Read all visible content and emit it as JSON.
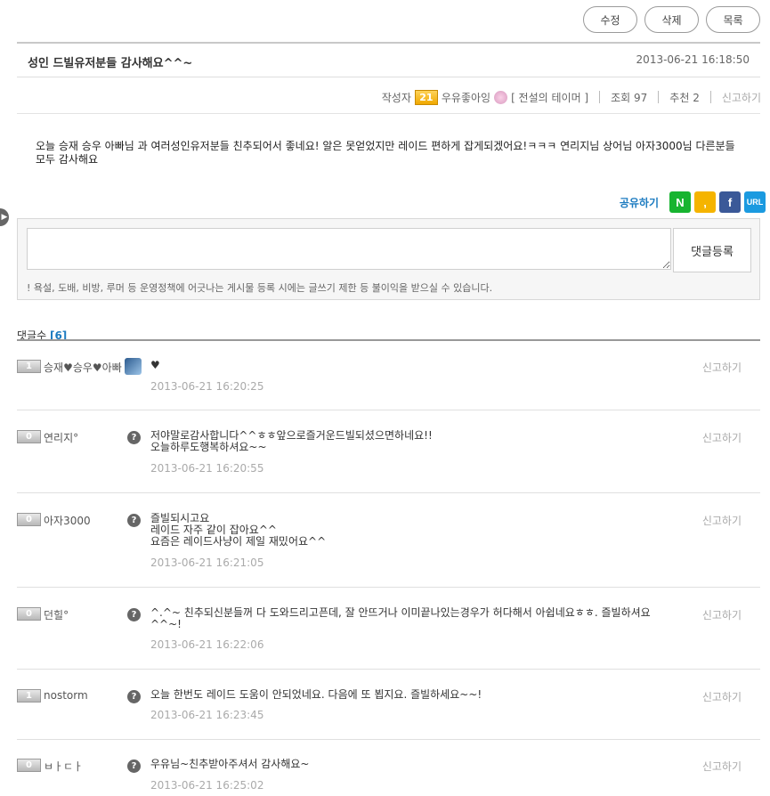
{
  "toolbar": {
    "edit": "수정",
    "delete": "삭제",
    "list": "목록"
  },
  "post": {
    "title": "성인 드빌유저분들 감사해요^^~",
    "date": "2013-06-21 16:18:50",
    "author_label": "작성자",
    "author_level": "21",
    "author_name": "우유좋아잉",
    "server": "[ 전설의 테이머 ]",
    "views": "조회 97",
    "recommend": "추천 2",
    "report": "신고하기",
    "body": "오늘 승재 승우 아빠님 과 여러성인유저분들 친추되어서 좋네요! 알은 못얻었지만 레이드 편하게 잡게되겠어요!ㅋㅋㅋ 연리지님 상어님 아자3000님 다른분들 모두 감사해요"
  },
  "share": {
    "label": "공유하기",
    "buttons": [
      {
        "name": "naver",
        "glyph": "N"
      },
      {
        "name": "kakao",
        "glyph": ","
      },
      {
        "name": "facebook",
        "glyph": "f"
      },
      {
        "name": "url",
        "glyph": "URL"
      }
    ]
  },
  "comment_form": {
    "submit": "댓글등록",
    "policy": "! 욕설, 도배, 비방, 루머 등 운영정책에 어긋나는 게시물 등록 시에는 글쓰기 제한 등 불이익을 받으실 수 있습니다."
  },
  "comments_header": {
    "label": "댓글수",
    "count": "[6]"
  },
  "comments": [
    {
      "level": "1",
      "name": "승재♥승우♥아빠",
      "icon": "avatar-image",
      "text": "♥",
      "date": "2013-06-21 16:20:25",
      "report": "신고하기"
    },
    {
      "level": "0",
      "name": "연리지°",
      "icon": "question-icon",
      "text": "저야말로감사합니다^^ㅎㅎ앞으로즐거운드빌되셨으면하네요!!\n오늘하루도행복하셔요~~",
      "date": "2013-06-21 16:20:55",
      "report": "신고하기"
    },
    {
      "level": "0",
      "name": "아자3000",
      "icon": "question-icon",
      "text": "즐빌되시고요\n레이드 자주 같이 잡아요^^\n요즘은 레이드사냥이 제일 재밌어요^^",
      "date": "2013-06-21 16:21:05",
      "report": "신고하기"
    },
    {
      "level": "0",
      "name": "던힐°",
      "icon": "question-icon",
      "text": "^.^~ 친추되신분들꺼 다 도와드리고픈데, 잘 안뜨거나 이미끝나있는경우가 허다해서 아쉽네요ㅎㅎ. 즐빌하셔요 ^^~!",
      "date": "2013-06-21 16:22:06",
      "report": "신고하기"
    },
    {
      "level": "1",
      "name": "nostorm",
      "icon": "question-icon",
      "text": "오늘 한번도 레이드 도움이 안되었네요. 다음에 또 뵙지요. 즐빌하세요~~!",
      "date": "2013-06-21 16:23:45",
      "report": "신고하기"
    },
    {
      "level": "0",
      "name": "ㅂㅏㄷㅏ",
      "icon": "question-icon",
      "text": "우유님~친추받아주셔서 감사해요~",
      "date": "2013-06-21 16:25:02",
      "report": "신고하기"
    }
  ]
}
